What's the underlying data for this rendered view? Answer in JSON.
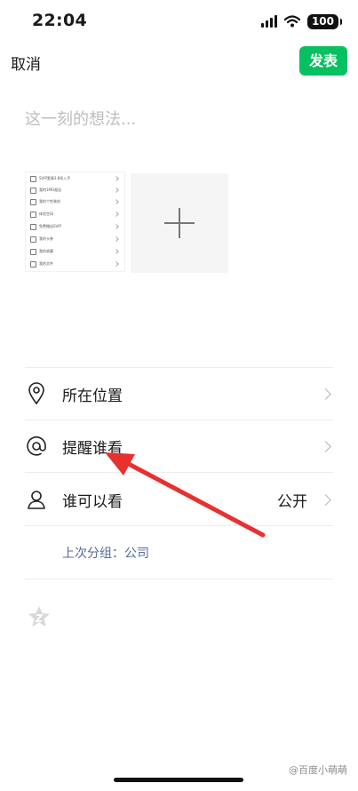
{
  "status": {
    "time": "22:04",
    "battery": "100"
  },
  "header": {
    "cancel": "取消",
    "publish": "发表"
  },
  "compose": {
    "placeholder": "这一刻的想法..."
  },
  "thumbnail_items": [
    "SVIP套餐3.8折入手",
    "我的1MG报告",
    "我的个性装扮",
    "体验空间",
    "免费赠送SVIP",
    "我的卡券",
    "我的收藏",
    "我的文件"
  ],
  "options": [
    {
      "label": "所在位置",
      "value": "",
      "icon": "location-pin-icon"
    },
    {
      "label": "提醒谁看",
      "value": "",
      "icon": "at-sign-icon"
    },
    {
      "label": "谁可以看",
      "value": "公开",
      "icon": "person-icon"
    }
  ],
  "last_group": "上次分组：公司",
  "watermark": "@百度小萌萌",
  "colors": {
    "accent": "#07c160",
    "link": "#576b95",
    "annotation_arrow": "#e8302f"
  }
}
